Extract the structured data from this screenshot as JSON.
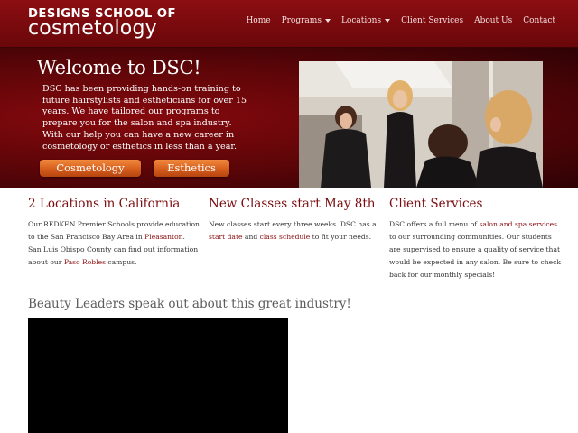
{
  "header": {
    "logo_top": "DESIGNS SCHOOL OF",
    "logo_bottom": "cosmetology",
    "nav": [
      {
        "label": "Home",
        "has_dropdown": false
      },
      {
        "label": "Programs",
        "has_dropdown": true
      },
      {
        "label": "Locations",
        "has_dropdown": true
      },
      {
        "label": "Client Services",
        "has_dropdown": false
      },
      {
        "label": "About Us",
        "has_dropdown": false
      },
      {
        "label": "Contact",
        "has_dropdown": false
      }
    ]
  },
  "hero": {
    "title": "Welcome to DSC!",
    "text": "DSC has been providing hands-on training to future hairstylists and estheticians for over 15 years. We have tailored our programs to prepare you for the salon and spa industry. With our help you can have a new career in cosmetology or esthetics in less than a year.",
    "button_cosmetology": "Cosmetology",
    "button_esthetics": "Esthetics"
  },
  "columns": {
    "locations": {
      "title": "2 Locations in California",
      "text_a": "Our REDKEN Premier Schools provide education to the San Francisco Bay Area in ",
      "link_pleasanton": "Pleasanton",
      "text_b": ". San Luis Obispo County can find out information about our ",
      "link_paso": "Paso Robles",
      "text_c": " campus."
    },
    "classes": {
      "title": "New Classes start May 8th",
      "text_a": "New classes start every three weeks. DSC has a ",
      "link_start": "start date",
      "text_b": " and ",
      "link_schedule": "class schedule",
      "text_c": " to fit your needs."
    },
    "services": {
      "title": "Client Services",
      "text_a": "DSC offers a full menu of ",
      "link_salon": "salon and spa services",
      "text_b": " to our surrounding communities. Our students are supervised to ensure a quality of service that would be expected in any salon. Be sure to check back for our monthly specials!"
    }
  },
  "video": {
    "heading": "Beauty Leaders speak out about this great industry!"
  },
  "colors": {
    "brand_red": "#7a0a0d",
    "button_orange": "#d65e1d",
    "link": "#8a0b0f"
  }
}
